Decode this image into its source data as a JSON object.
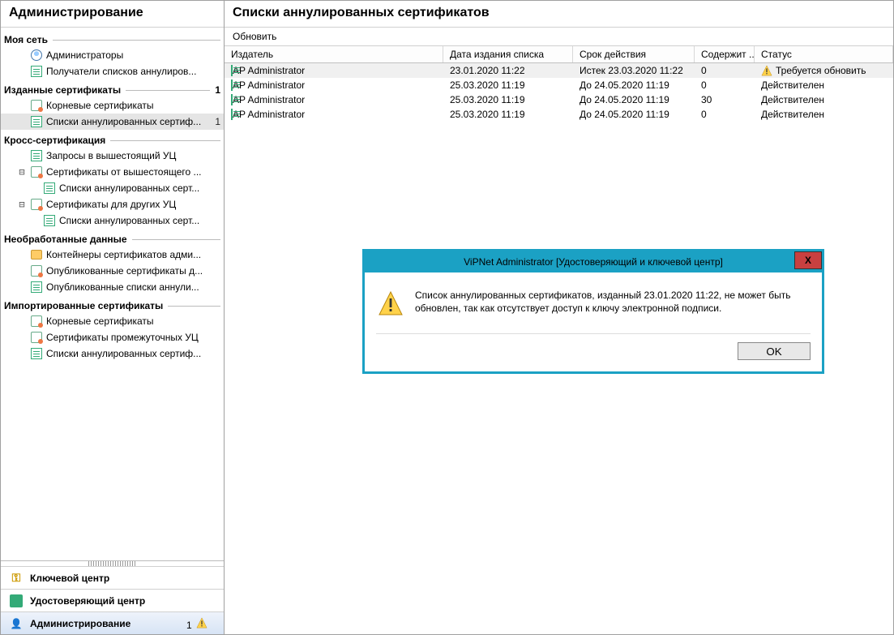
{
  "sidebar": {
    "title": "Администрирование",
    "sections": [
      {
        "label": "Моя сеть",
        "count": null,
        "items": [
          {
            "label": "Администраторы",
            "icon": "user-icon",
            "indent": 1
          },
          {
            "label": "Получатели списков аннулиров...",
            "icon": "list-icon",
            "indent": 1
          }
        ]
      },
      {
        "label": "Изданные сертификаты",
        "count": "1",
        "items": [
          {
            "label": "Корневые сертификаты",
            "icon": "cert-icon",
            "indent": 1
          },
          {
            "label": "Списки аннулированных сертиф...",
            "icon": "list-icon",
            "indent": 1,
            "count": "1",
            "selected": true
          }
        ]
      },
      {
        "label": "Кросс-сертификация",
        "count": null,
        "items": [
          {
            "label": "Запросы в вышестоящий УЦ",
            "icon": "list-icon",
            "indent": 1
          },
          {
            "label": "Сертификаты от вышестоящего ...",
            "icon": "cert-icon",
            "indent": 1,
            "expander": "⊟"
          },
          {
            "label": "Списки аннулированных серт...",
            "icon": "list-icon",
            "indent": 2
          },
          {
            "label": "Сертификаты для других УЦ",
            "icon": "cert-icon",
            "indent": 1,
            "expander": "⊟"
          },
          {
            "label": "Списки аннулированных серт...",
            "icon": "list-icon",
            "indent": 2
          }
        ]
      },
      {
        "label": "Необработанные данные",
        "count": null,
        "items": [
          {
            "label": "Контейнеры сертификатов адми...",
            "icon": "folder-icon",
            "indent": 1
          },
          {
            "label": "Опубликованные сертификаты д...",
            "icon": "cert-icon",
            "indent": 1
          },
          {
            "label": "Опубликованные списки аннули...",
            "icon": "list-icon",
            "indent": 1
          }
        ]
      },
      {
        "label": "Импортированные сертификаты",
        "count": null,
        "items": [
          {
            "label": "Корневые сертификаты",
            "icon": "cert-icon",
            "indent": 1
          },
          {
            "label": "Сертификаты промежуточных УЦ",
            "icon": "cert-icon",
            "indent": 1
          },
          {
            "label": "Списки аннулированных сертиф...",
            "icon": "list-icon",
            "indent": 1
          }
        ]
      }
    ],
    "bottom": [
      {
        "label": "Ключевой центр",
        "icon": "key-icon"
      },
      {
        "label": "Удостоверяющий центр",
        "icon": "cert-center-icon"
      },
      {
        "label": "Администрирование",
        "icon": "admin-icon",
        "active": true,
        "badge_count": "1",
        "badge_warn": true
      }
    ]
  },
  "main": {
    "title": "Списки аннулированных сертификатов",
    "toolbar": {
      "refresh": "Обновить"
    },
    "columns": {
      "issuer": "Издатель",
      "date": "Дата издания списка",
      "valid": "Срок действия",
      "count": "Содержит ...",
      "status": "Статус"
    },
    "rows": [
      {
        "issuer": "AP Administrator",
        "date": "23.01.2020 11:22",
        "valid": "Истек 23.03.2020 11:22",
        "count": "0",
        "status": "Требуется обновить",
        "warn": true,
        "selected": true
      },
      {
        "issuer": "AP Administrator",
        "date": "25.03.2020 11:19",
        "valid": "До 24.05.2020 11:19",
        "count": "0",
        "status": "Действителен"
      },
      {
        "issuer": "AP Administrator",
        "date": "25.03.2020 11:19",
        "valid": "До 24.05.2020 11:19",
        "count": "30",
        "status": "Действителен"
      },
      {
        "issuer": "AP Administrator",
        "date": "25.03.2020 11:19",
        "valid": "До 24.05.2020 11:19",
        "count": "0",
        "status": "Действителен"
      }
    ]
  },
  "dialog": {
    "title": "ViPNet Administrator [Удостоверяющий и ключевой центр]",
    "message": "Список аннулированных сертификатов, изданный 23.01.2020 11:22, не может быть обновлен, так как отсутствует доступ к ключу электронной подписи.",
    "ok": "OK",
    "close": "X"
  }
}
